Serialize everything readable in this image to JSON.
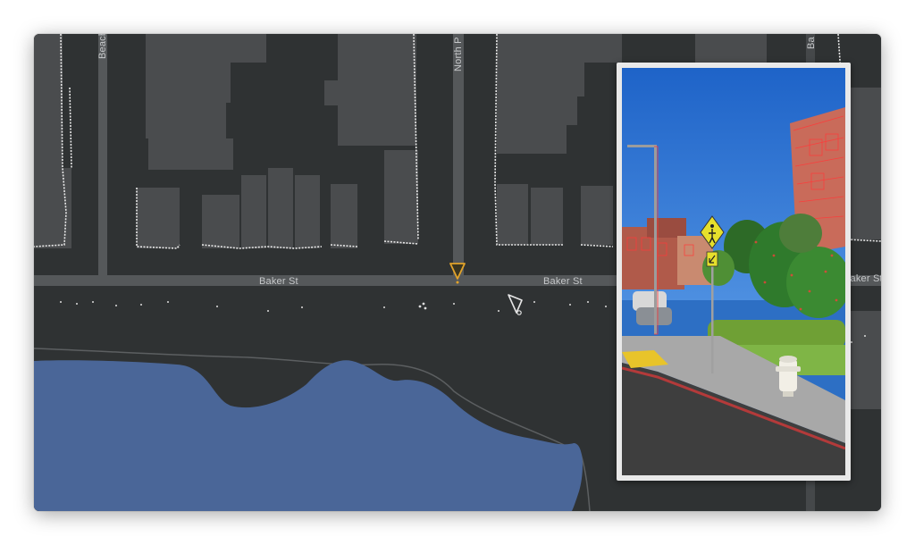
{
  "map": {
    "streets": {
      "baker_left": "Baker St",
      "baker_right": "Baker St",
      "baker_edge": "Baker St",
      "beach": "Beach",
      "north_point": "North P",
      "baker_vertical": "Ba"
    },
    "markers": {
      "active_camera": "camera-marker-active",
      "other_camera": "camera-marker"
    },
    "colors": {
      "background": "#2f3233",
      "building": "#4a4c4e",
      "road": "#55585a",
      "water": "#4a6698",
      "active_marker": "#e2a32a"
    }
  },
  "photo": {
    "sign_icon": "pedestrian-crossing-sign-icon",
    "arrow_icon": "down-left-arrow-icon"
  }
}
